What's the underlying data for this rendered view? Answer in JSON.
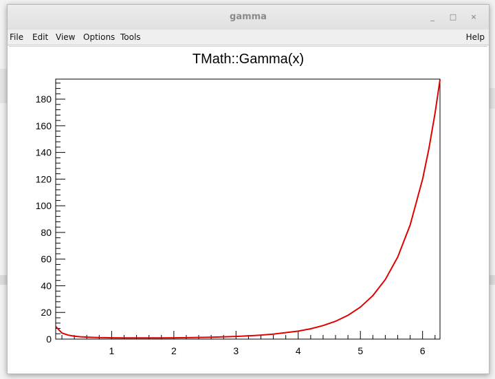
{
  "window": {
    "title": "gamma",
    "controls": {
      "minimize": "_",
      "maximize": "□",
      "close": "×"
    }
  },
  "menu": {
    "file": "File",
    "edit": "Edit",
    "view": "View",
    "options": "Options",
    "tools": "Tools",
    "help": "Help"
  },
  "chart_data": {
    "type": "line",
    "title": "TMath::Gamma(x)",
    "xlabel": "",
    "ylabel": "",
    "xlim": [
      0.1,
      6.28
    ],
    "ylim": [
      0,
      195
    ],
    "x_ticks": [
      1,
      2,
      3,
      4,
      5,
      6
    ],
    "y_ticks": [
      0,
      20,
      40,
      60,
      80,
      100,
      120,
      140,
      160,
      180
    ],
    "grid": false,
    "legend": "none",
    "line_color": "#e00000",
    "series": [
      {
        "x": [
          0.1,
          0.2,
          0.3,
          0.4,
          0.5,
          0.6,
          0.7,
          0.8,
          0.9,
          1.0,
          1.2,
          1.4,
          1.6,
          1.8,
          2.0,
          2.3,
          2.6,
          3.0,
          3.3,
          3.6,
          4.0,
          4.2,
          4.4,
          4.6,
          4.8,
          5.0,
          5.2,
          5.4,
          5.6,
          5.8,
          6.0,
          6.1,
          6.2,
          6.28
        ],
        "values": [
          9.51,
          4.59,
          2.99,
          2.22,
          1.77,
          1.49,
          1.3,
          1.16,
          1.07,
          1.0,
          0.92,
          0.89,
          0.89,
          0.93,
          1.0,
          1.17,
          1.43,
          2.0,
          2.68,
          3.72,
          6.0,
          7.76,
          10.14,
          13.38,
          17.84,
          24.0,
          32.58,
          44.6,
          61.55,
          85.62,
          120.0,
          142.45,
          169.41,
          194.57
        ]
      }
    ]
  }
}
